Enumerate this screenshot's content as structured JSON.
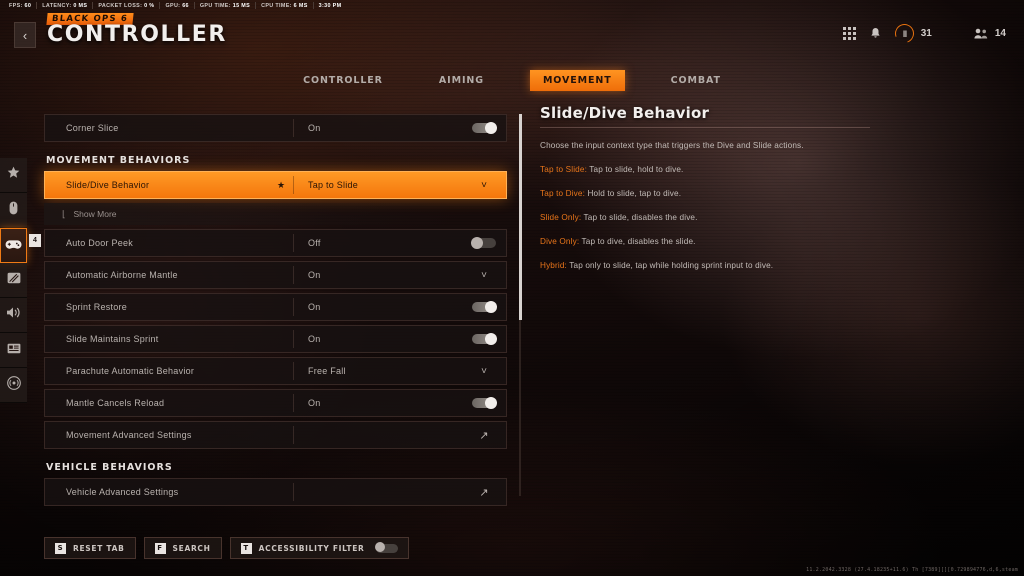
{
  "stats": [
    {
      "label": "FPS:",
      "value": "60"
    },
    {
      "label": "LATENCY:",
      "value": "0 MS"
    },
    {
      "label": "PACKET LOSS:",
      "value": "0 %"
    },
    {
      "label": "GPU:",
      "value": "66"
    },
    {
      "label": "GPU TIME:",
      "value": "15 MS"
    },
    {
      "label": "CPU TIME:",
      "value": "6 MS"
    },
    {
      "label": "",
      "value": "3:30 PM"
    }
  ],
  "header": {
    "back_icon": "chevron-left-icon",
    "logo": "BLACK OPS 6",
    "title": "CONTROLLER",
    "grid_icon": "grid-icon",
    "bell_icon": "bell-icon",
    "battlepass_value": "31",
    "friends_value": "14"
  },
  "tabs": [
    {
      "label": "CONTROLLER",
      "active": false
    },
    {
      "label": "AIMING",
      "active": false
    },
    {
      "label": "MOVEMENT",
      "active": true
    },
    {
      "label": "COMBAT",
      "active": false
    }
  ],
  "rail": {
    "items": [
      {
        "icon": "star-icon",
        "selected": false
      },
      {
        "icon": "mouse-icon",
        "selected": false
      },
      {
        "icon": "gamepad-icon",
        "selected": true
      },
      {
        "icon": "display-icon",
        "selected": false
      },
      {
        "icon": "speaker-icon",
        "selected": false
      },
      {
        "icon": "account-icon",
        "selected": false
      },
      {
        "icon": "network-icon",
        "selected": false
      }
    ],
    "badge": "4"
  },
  "list": [
    {
      "kind": "row",
      "name": "corner-slice",
      "label": "Corner Slice",
      "value": "On",
      "control": "toggle-on",
      "star": false,
      "selected": false
    },
    {
      "kind": "section",
      "label": "MOVEMENT BEHAVIORS"
    },
    {
      "kind": "row",
      "name": "slide-dive-behavior",
      "label": "Slide/Dive Behavior",
      "value": "Tap to Slide",
      "control": "chevron",
      "star": true,
      "selected": true
    },
    {
      "kind": "sub",
      "name": "show-more",
      "label": "Show More"
    },
    {
      "kind": "row",
      "name": "auto-door-peek",
      "label": "Auto Door Peek",
      "value": "Off",
      "control": "toggle-off",
      "star": false,
      "selected": false
    },
    {
      "kind": "row",
      "name": "automatic-airborne-mantle",
      "label": "Automatic Airborne Mantle",
      "value": "On",
      "control": "chevron",
      "star": false,
      "selected": false
    },
    {
      "kind": "row",
      "name": "sprint-restore",
      "label": "Sprint Restore",
      "value": "On",
      "control": "toggle-on",
      "star": false,
      "selected": false
    },
    {
      "kind": "row",
      "name": "slide-maintains-sprint",
      "label": "Slide Maintains Sprint",
      "value": "On",
      "control": "toggle-on",
      "star": false,
      "selected": false
    },
    {
      "kind": "row",
      "name": "parachute-automatic-behavior",
      "label": "Parachute Automatic Behavior",
      "value": "Free Fall",
      "control": "chevron",
      "star": false,
      "selected": false
    },
    {
      "kind": "row",
      "name": "mantle-cancels-reload",
      "label": "Mantle Cancels Reload",
      "value": "On",
      "control": "toggle-on",
      "star": false,
      "selected": false
    },
    {
      "kind": "row",
      "name": "movement-advanced-settings",
      "label": "Movement Advanced Settings",
      "value": "",
      "control": "external",
      "star": false,
      "selected": false
    },
    {
      "kind": "section",
      "label": "VEHICLE BEHAVIORS"
    },
    {
      "kind": "row",
      "name": "vehicle-advanced-settings",
      "label": "Vehicle Advanced Settings",
      "value": "",
      "control": "external",
      "star": false,
      "selected": false
    }
  ],
  "info": {
    "title": "Slide/Dive Behavior",
    "intro": "Choose the input context type that triggers the Dive and Slide actions.",
    "options": [
      {
        "name": "Tap to Slide:",
        "desc": "Tap to slide, hold to dive."
      },
      {
        "name": "Tap to Dive:",
        "desc": "Hold to slide, tap to dive."
      },
      {
        "name": "Slide Only:",
        "desc": "Tap to slide, disables the dive."
      },
      {
        "name": "Dive Only:",
        "desc": "Tap to dive, disables the slide."
      },
      {
        "name": "Hybrid:",
        "desc": "Tap only to slide, tap while holding sprint input to dive."
      }
    ]
  },
  "bottom": [
    {
      "key": "S",
      "label": "RESET TAB",
      "toggle": null
    },
    {
      "key": "F",
      "label": "SEARCH",
      "toggle": null
    },
    {
      "key": "T",
      "label": "ACCESSIBILITY FILTER",
      "toggle": "off"
    }
  ],
  "build": "11.2.2042.3328 (27.4.18235+11.6) Th [7389][][0.729894776,d,6,steam"
}
